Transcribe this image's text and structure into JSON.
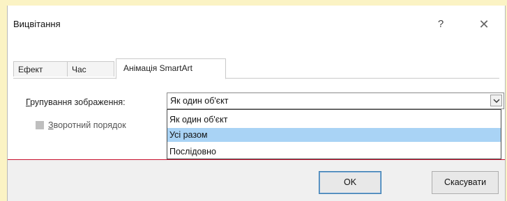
{
  "window": {
    "title": "Вицвітання",
    "help_glyph": "?",
    "close_glyph": "✕"
  },
  "tabs": [
    {
      "label": "Ефект"
    },
    {
      "label": "Час"
    },
    {
      "label": "Анімація SmartArt"
    }
  ],
  "grouping": {
    "label_underlined": "Г",
    "label_rest": "рупування зображення:",
    "selected_value": "Як один об'єкт",
    "options": [
      "Як один об'єкт",
      "Усі разом",
      "Послідовно"
    ],
    "highlighted_option": "Усі разом"
  },
  "reverse_order": {
    "label_underlined": "З",
    "label_rest": "воротний порядок",
    "checked": false
  },
  "buttons": {
    "ok": "OK",
    "cancel": "Скасувати"
  },
  "colors": {
    "highlight": "#a9d3f5",
    "default_button_border": "#3c7fb1",
    "separator": "#c8102e"
  }
}
